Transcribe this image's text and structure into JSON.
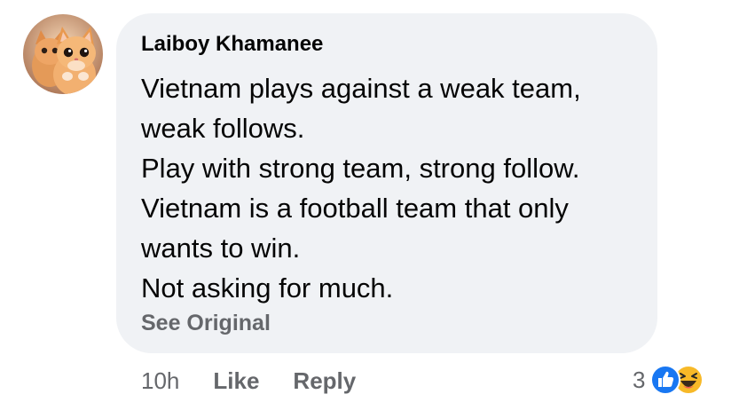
{
  "comment": {
    "author": "Laiboy Khamanee",
    "avatar_icon": "kitten-avatar",
    "body_lines": [
      "Vietnam plays against a weak team,",
      "weak follows.",
      "Play with strong team, strong follow.",
      "Vietnam is a football team that only",
      "wants to win.",
      "Not asking for much."
    ],
    "see_original_label": "See Original"
  },
  "actions": {
    "timestamp": "10h",
    "like_label": "Like",
    "reply_label": "Reply"
  },
  "reactions": {
    "count": "3",
    "icons": [
      "like-icon",
      "haha-icon"
    ],
    "colors": {
      "like": "#1877f2",
      "haha": "#f7b928"
    }
  },
  "colors": {
    "bubble_background": "#f0f2f5",
    "primary_text": "#050505",
    "secondary_text": "#65676b"
  }
}
